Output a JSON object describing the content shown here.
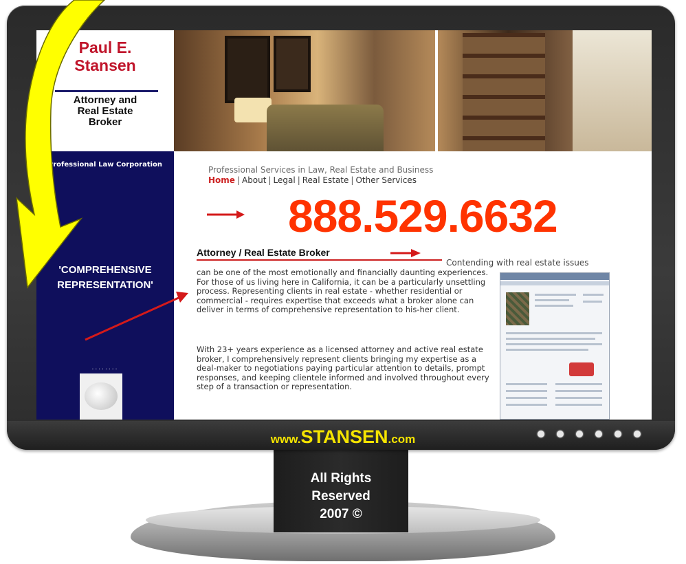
{
  "monitor": {
    "site_url_prefix": "www.",
    "site_url_brand": "STANSEN",
    "site_url_suffix": ".com",
    "rights_line1": "All Rights",
    "rights_line2": "Reserved",
    "rights_line3": "2007 ©"
  },
  "logo": {
    "name_line1": "Paul E.",
    "name_line2": "Stansen",
    "title_line1": "Attorney and",
    "title_line2": "Real Estate",
    "title_line3": "Broker"
  },
  "sidebar": {
    "corporation": "Professional Law Corporation",
    "quote_line1": "'COMPREHENSIVE",
    "quote_line2": "REPRESENTATION'",
    "dots": "........"
  },
  "header": {
    "tagline": "Professional Services in Law, Real Estate and Business"
  },
  "nav": {
    "items": [
      {
        "label": "Home"
      },
      {
        "label": "About"
      },
      {
        "label": "Legal"
      },
      {
        "label": "Real Estate"
      },
      {
        "label": "Other Services"
      }
    ]
  },
  "phone": "888.529.6632",
  "content": {
    "headline": "Attorney / Real Estate Broker",
    "lead_inline": "Contending with real estate issues",
    "paragraph1": "can be one of the most emotionally and financially daunting experiences. For those of us living here in California, it can be a particularly unsettling process. Representing clients in real estate - whether residential or commercial - requires expertise that exceeds what a broker alone can deliver in terms of comprehensive representation to his-her client.",
    "paragraph2": "With 23+ years experience as a licensed attorney and active real estate broker, I comprehensively represent clients bringing my expertise as a deal-maker to negotiations paying particular attention to details, prompt responses, and keeping clientele informed and involved throughout every step of a transaction or representation."
  },
  "colors": {
    "accent_red": "#ff3300",
    "sidebar_navy": "#0f0f5c",
    "url_yellow": "#f5e400",
    "arrow_yellow": "#ffff00"
  }
}
